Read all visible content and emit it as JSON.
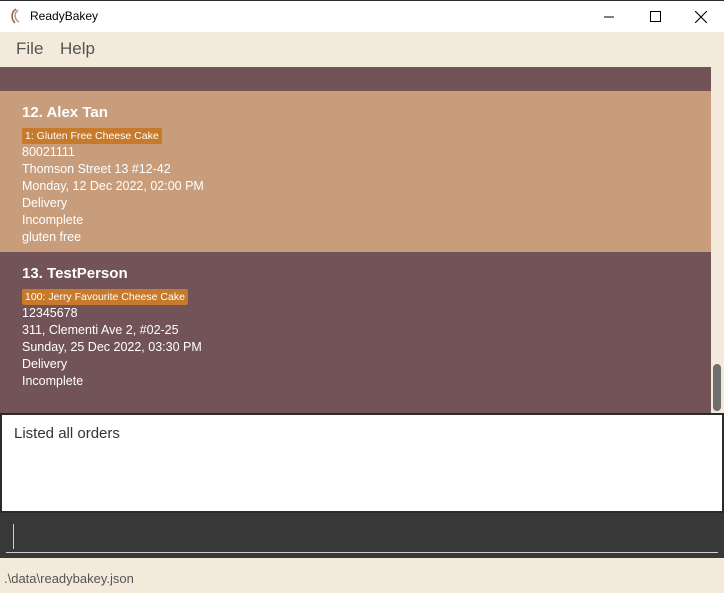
{
  "window": {
    "title": "ReadyBakey",
    "minimize_icon": "minimize-icon",
    "maximize_icon": "maximize-icon",
    "close_icon": "close-icon"
  },
  "menu": {
    "items": [
      {
        "label": "File"
      },
      {
        "label": "Help"
      }
    ]
  },
  "orders": [
    {
      "title": "12.  Alex Tan",
      "tag": "1: Gluten Free Cheese Cake",
      "phone": "80021111",
      "address": "Thomson Street 13 #12-42",
      "datetime": "Monday, 12 Dec 2022, 02:00 PM",
      "delivery": "Delivery",
      "status": "Incomplete",
      "note": "gluten free",
      "selected": true
    },
    {
      "title": "13.  TestPerson",
      "tag": "100: Jerry Favourite Cheese Cake",
      "phone": "12345678",
      "address": "311, Clementi Ave 2, #02-25",
      "datetime": "Sunday, 25 Dec 2022, 03:30 PM",
      "delivery": "Delivery",
      "status": "Incomplete",
      "note": "",
      "selected": false
    }
  ],
  "result": {
    "text": "Listed all orders"
  },
  "command": {
    "value": ""
  },
  "status": {
    "path": ".\\data\\readybakey.json"
  },
  "colors": {
    "list_bg": "#725357",
    "selected_card": "#c89d7c",
    "tag": "#c77a2c",
    "menu_bg": "#f3eadb",
    "command_bg": "#383838"
  }
}
